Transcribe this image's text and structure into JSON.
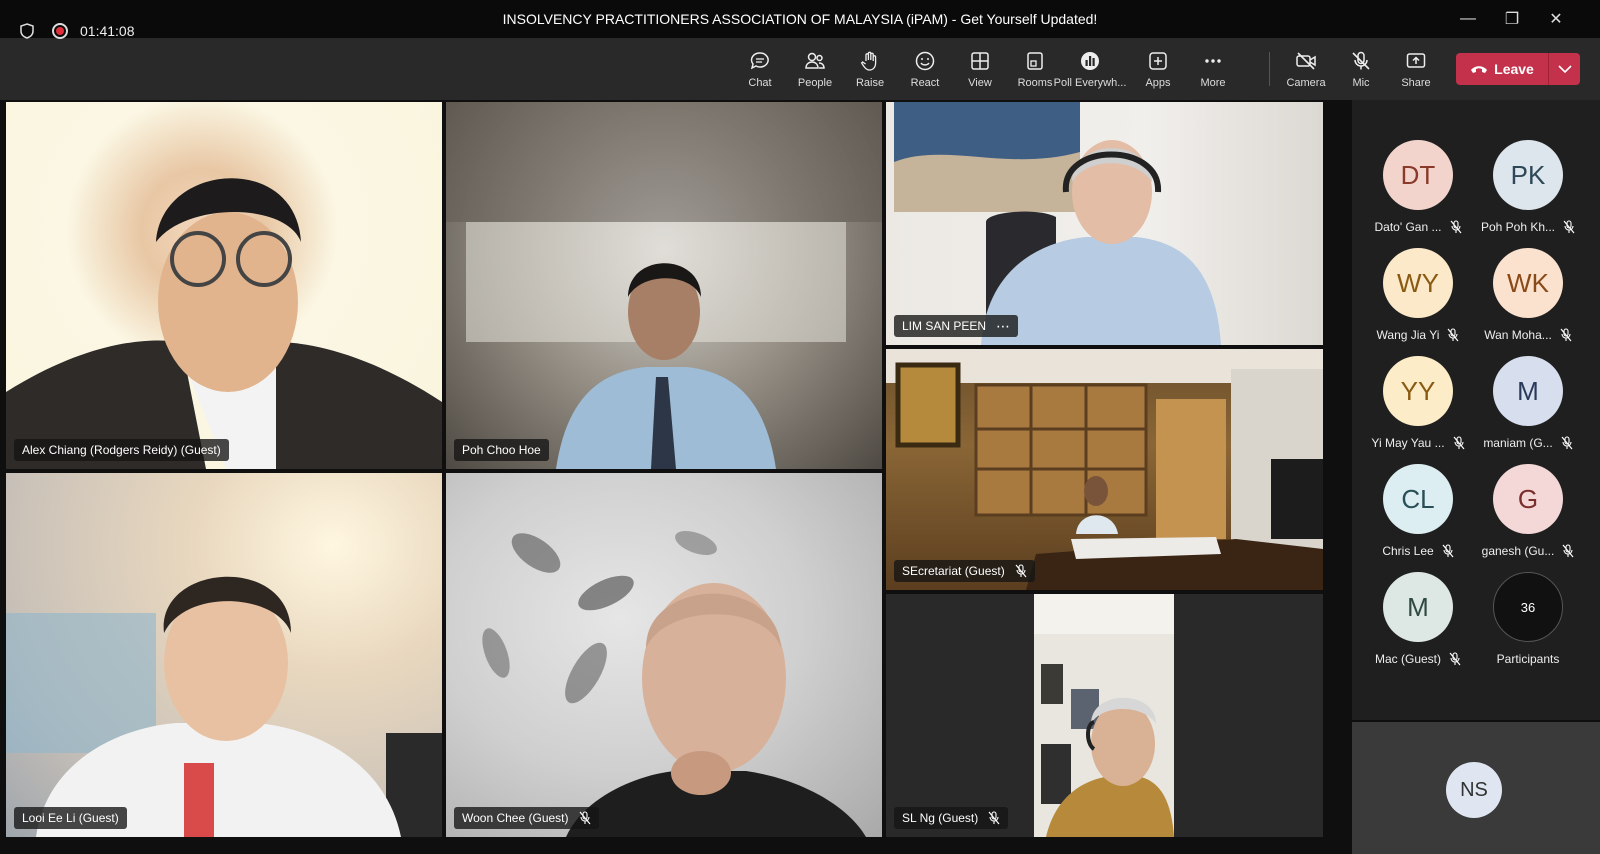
{
  "window": {
    "title": "INSOLVENCY PRACTITIONERS ASSOCIATION OF MALAYSIA (iPAM) - Get Yourself Updated!"
  },
  "toolbar": {
    "timer": "01:41:08",
    "buttons": [
      {
        "label": "Chat",
        "icon": "chat-icon"
      },
      {
        "label": "People",
        "icon": "people-icon"
      },
      {
        "label": "Raise",
        "icon": "raise-hand-icon"
      },
      {
        "label": "React",
        "icon": "react-icon"
      },
      {
        "label": "View",
        "icon": "view-icon"
      },
      {
        "label": "Rooms",
        "icon": "rooms-icon"
      },
      {
        "label": "Poll Everywh...",
        "icon": "poll-icon"
      },
      {
        "label": "Apps",
        "icon": "apps-icon"
      },
      {
        "label": "More",
        "icon": "more-icon"
      },
      {
        "label": "Camera",
        "icon": "camera-off-icon"
      },
      {
        "label": "Mic",
        "icon": "mic-off-icon"
      },
      {
        "label": "Share",
        "icon": "share-icon"
      }
    ],
    "leave_label": "Leave",
    "leave_color": "#c4314b"
  },
  "video_tiles": [
    {
      "name": "Alex Chiang (Rodgers Reidy) (Guest)",
      "muted": false
    },
    {
      "name": "Poh Choo Hoe",
      "muted": false
    },
    {
      "name": "LIM SAN PEEN",
      "muted": false,
      "more": "⋯"
    },
    {
      "name": "SEcretariat (Guest)",
      "muted": true
    },
    {
      "name": "Looi Ee Li (Guest)",
      "muted": false
    },
    {
      "name": "Woon Chee (Guest)",
      "muted": true
    },
    {
      "name": "SL Ng (Guest)",
      "muted": true
    }
  ],
  "participants": [
    {
      "initials": "DT",
      "name": "Dato' Gan ...",
      "color": "#f3d4cd"
    },
    {
      "initials": "PK",
      "name": "Poh Poh Kh...",
      "color": "#dde6ec"
    },
    {
      "initials": "WY",
      "name": "Wang Jia Yi",
      "color": "#fbe9c9"
    },
    {
      "initials": "WK",
      "name": "Wan Moha...",
      "color": "#fbe2cf"
    },
    {
      "initials": "YY",
      "name": "Yi May Yau ...",
      "color": "#fcedc8"
    },
    {
      "initials": "M",
      "name": "maniam (G...",
      "color": "#d7dfee"
    },
    {
      "initials": "CL",
      "name": "Chris Lee",
      "color": "#dceef1"
    },
    {
      "initials": "G",
      "name": "ganesh (Gu...",
      "color": "#f4d8d8"
    },
    {
      "initials": "M",
      "name": "Mac (Guest)",
      "color": "#dde7e3"
    }
  ],
  "participant_count": {
    "value": "36",
    "label": "Participants"
  },
  "self_view": {
    "initials": "NS"
  }
}
